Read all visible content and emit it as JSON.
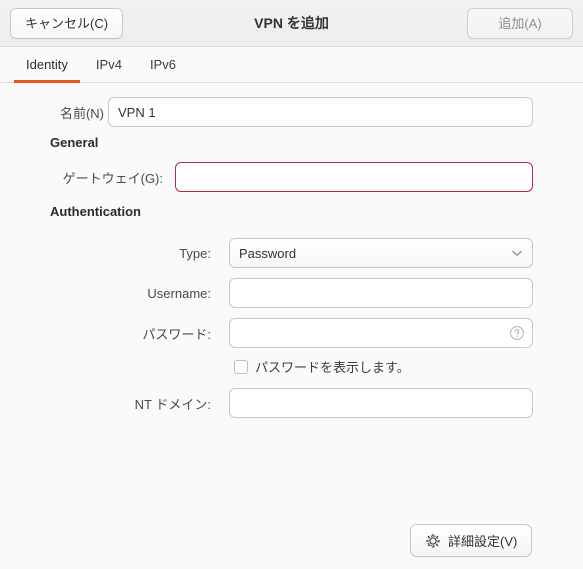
{
  "window": {
    "title": "VPN を追加",
    "accent_color": "#e95420",
    "error_color": "#b52c3b",
    "background": "#fafafa",
    "headerbar_background": "#f0efee"
  },
  "headerbar": {
    "cancel_label": "キャンセル(C)",
    "add_label": "追加(A)",
    "add_enabled": false
  },
  "tabs": [
    {
      "label": "Identity",
      "active": true
    },
    {
      "label": "IPv4",
      "active": false
    },
    {
      "label": "IPv6",
      "active": false
    }
  ],
  "form": {
    "name": {
      "label": "名前(N)",
      "value": "VPN 1",
      "placeholder": ""
    },
    "general_heading": "General",
    "gateway": {
      "label": "ゲートウェイ(G):",
      "value": "",
      "placeholder": "",
      "invalid": true
    },
    "authentication_heading": "Authentication",
    "type": {
      "label": "Type:",
      "selected": "Password",
      "options": [
        "Password"
      ],
      "chevron_icon": "chevron-down-icon"
    },
    "username": {
      "label": "Username:",
      "value": "",
      "placeholder": ""
    },
    "password": {
      "label": "パスワード:",
      "value": "",
      "placeholder": "",
      "help_icon": "help-circle-icon"
    },
    "show_password": {
      "label": "パスワードを表示します。",
      "checked": false
    },
    "nt_domain": {
      "label": "NT ドメイン:",
      "value": "",
      "placeholder": ""
    }
  },
  "footer": {
    "advanced_label": "詳細設定(V)",
    "advanced_icon": "gear-icon"
  }
}
